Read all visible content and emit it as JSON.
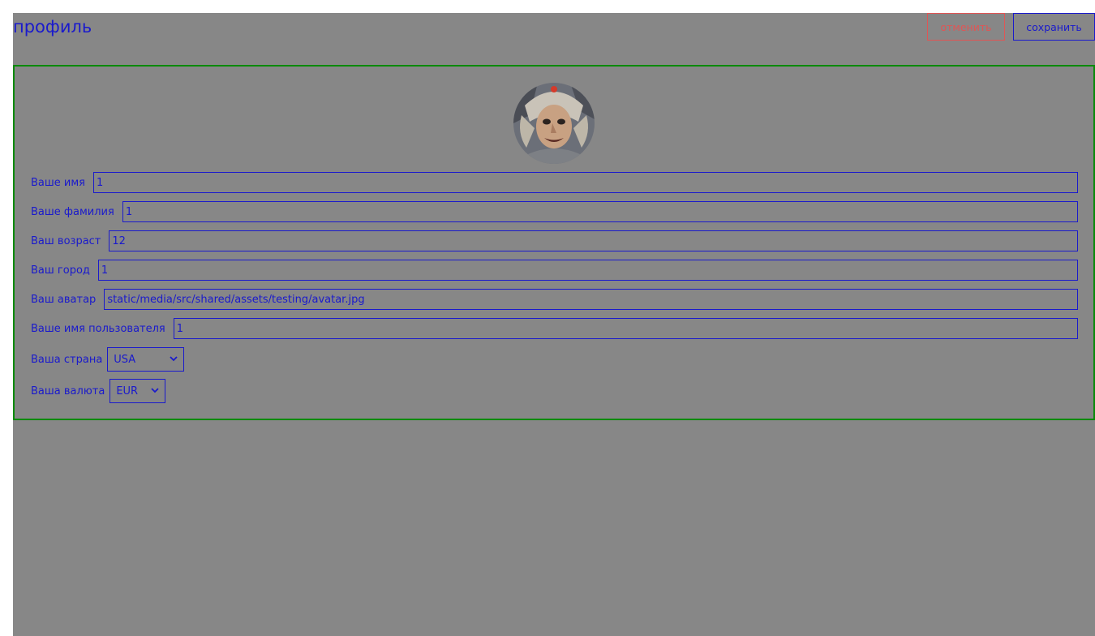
{
  "header": {
    "title": "профиль",
    "cancel_label": "отменить",
    "save_label": "сохранить"
  },
  "profile": {
    "avatar_alt": "avatar",
    "fields": {
      "first_name": {
        "label": "Ваше имя",
        "value": "1"
      },
      "last_name": {
        "label": "Ваше фамилия",
        "value": "1"
      },
      "age": {
        "label": "Ваш возраст",
        "value": "12"
      },
      "city": {
        "label": "Ваш город",
        "value": "1"
      },
      "avatar": {
        "label": "Ваш аватар",
        "value": "static/media/src/shared/assets/testing/avatar.jpg"
      },
      "username": {
        "label": "Ваше имя пользователя",
        "value": "1"
      }
    },
    "country": {
      "label": "Ваша страна",
      "selected": "USA"
    },
    "currency": {
      "label": "Ваша валюта",
      "selected": "EUR"
    }
  },
  "colors": {
    "background": "#878787",
    "accent": "#1a1acc",
    "danger": "#e05555",
    "card_border": "#0a8a0a"
  },
  "icons": {
    "select_arrow": "chevron-down-icon"
  }
}
